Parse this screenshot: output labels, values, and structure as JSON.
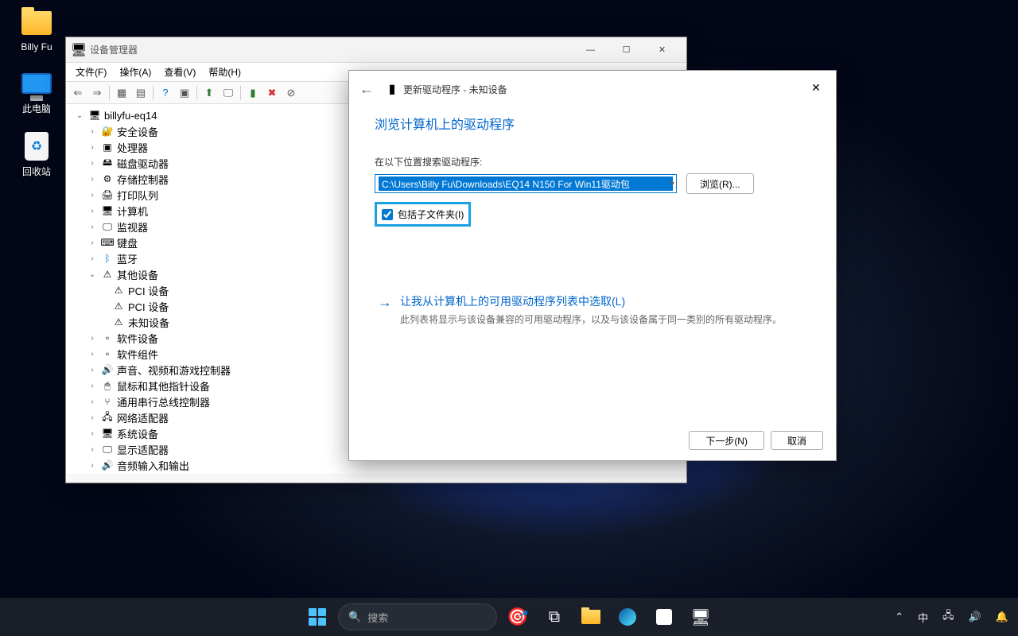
{
  "desktop": {
    "icons": [
      {
        "label": "Billy Fu"
      },
      {
        "label": "此电脑"
      },
      {
        "label": "回收站"
      }
    ]
  },
  "devmgr": {
    "title": "设备管理器",
    "menus": {
      "file": "文件(F)",
      "action": "操作(A)",
      "view": "查看(V)",
      "help": "帮助(H)"
    },
    "root": "billyfu-eq14",
    "nodes": {
      "security": "安全设备",
      "cpu": "处理器",
      "disk": "磁盘驱动器",
      "storage": "存储控制器",
      "printq": "打印队列",
      "computer": "计算机",
      "monitor": "监视器",
      "keyboard": "键盘",
      "bluetooth": "蓝牙",
      "other": "其他设备",
      "pci1": "PCI 设备",
      "pci2": "PCI 设备",
      "unknown": "未知设备",
      "softdev": "软件设备",
      "softcomp": "软件组件",
      "sound": "声音、视频和游戏控制器",
      "mouse": "鼠标和其他指针设备",
      "usb": "通用串行总线控制器",
      "network": "网络适配器",
      "system": "系统设备",
      "display": "显示适配器",
      "audio": "音频输入和输出"
    }
  },
  "wizard": {
    "title": "更新驱动程序 - 未知设备",
    "heading": "浏览计算机上的驱动程序",
    "search_label": "在以下位置搜索驱动程序:",
    "path": "C:\\Users\\Billy Fu\\Downloads\\EQ14 N150 For Win11驱动包",
    "browse": "浏览(R)...",
    "include_sub": "包括子文件夹(I)",
    "pick_title": "让我从计算机上的可用驱动程序列表中选取(L)",
    "pick_desc": "此列表将显示与该设备兼容的可用驱动程序，以及与该设备属于同一类别的所有驱动程序。",
    "next": "下一步(N)",
    "cancel": "取消"
  },
  "taskbar": {
    "search_placeholder": "搜索",
    "ime": "中"
  }
}
